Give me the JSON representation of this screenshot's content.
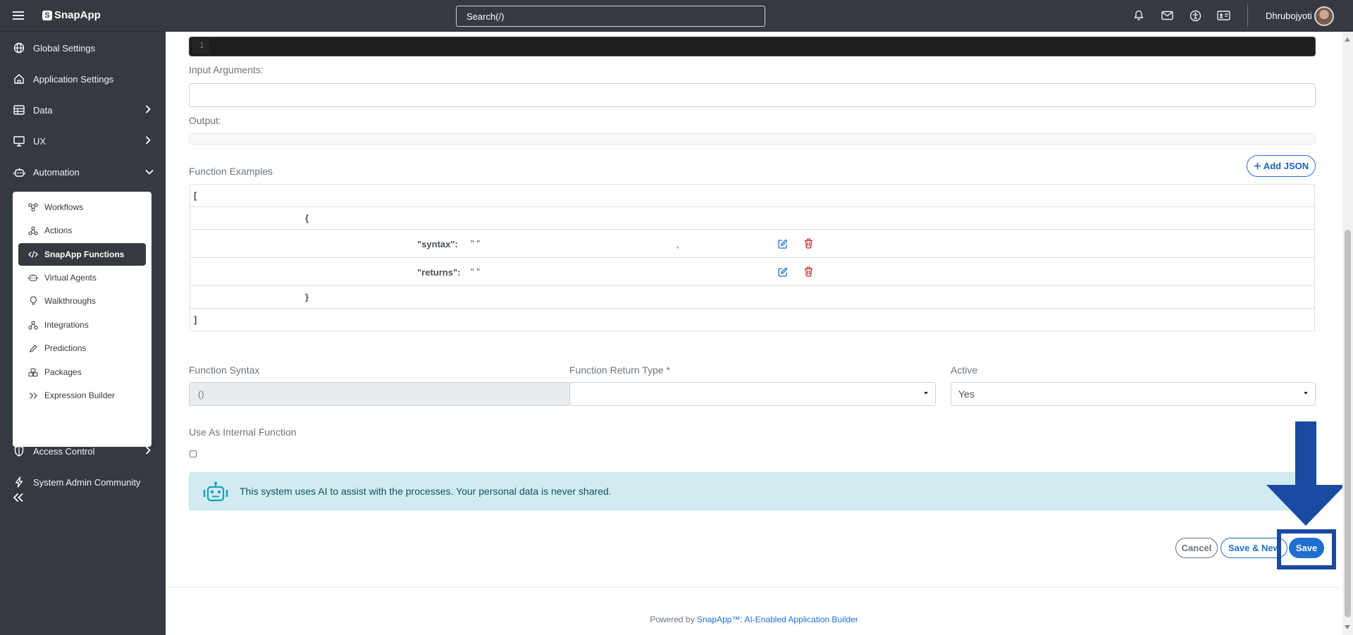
{
  "topbar": {
    "app_name": "SnapApp",
    "search_placeholder": "Search(/)",
    "user_name": "Dhrubojyoti",
    "icons": [
      "bell-icon",
      "mail-icon",
      "accessibility-icon",
      "id-card-icon"
    ]
  },
  "sidebar": {
    "items": [
      {
        "label": "Global Settings",
        "icon": "globe-icon"
      },
      {
        "label": "Application Settings",
        "icon": "home-icon"
      },
      {
        "label": "Data",
        "icon": "table-icon",
        "chevron": "right"
      },
      {
        "label": "UX",
        "icon": "monitor-icon",
        "chevron": "right"
      },
      {
        "label": "Automation",
        "icon": "robot-icon",
        "chevron": "down"
      },
      {
        "label": "Access Control",
        "icon": "shield-icon",
        "chevron": "right"
      },
      {
        "label": "System Admin Community",
        "icon": "bolt-icon"
      }
    ],
    "submenu": [
      {
        "label": "Workflows",
        "icon": "workflow-icon"
      },
      {
        "label": "Actions",
        "icon": "actions-icon"
      },
      {
        "label": "SnapApp Functions",
        "icon": "code-icon",
        "active": true
      },
      {
        "label": "Virtual Agents",
        "icon": "robot-icon"
      },
      {
        "label": "Walkthroughs",
        "icon": "lightbulb-icon"
      },
      {
        "label": "Integrations",
        "icon": "integrations-icon"
      },
      {
        "label": "Predictions",
        "icon": "pencil-icon"
      },
      {
        "label": "Packages",
        "icon": "packages-icon"
      },
      {
        "label": "Expression Builder",
        "icon": "double-chevron-icon"
      }
    ]
  },
  "editor": {
    "line_number": "1"
  },
  "form": {
    "input_arguments_label": "Input Arguments:",
    "output_label": "Output:",
    "function_examples_label": "Function Examples",
    "add_json_label": "Add JSON",
    "json": {
      "open_bracket": "[",
      "open_brace": "{",
      "syntax_key": "\"syntax\":",
      "syntax_value": "\" \"",
      "comma": ",",
      "returns_key": "\"returns\":",
      "returns_value": "\" \"",
      "close_brace": "}",
      "close_bracket": "]"
    },
    "function_syntax_label": "Function Syntax",
    "function_syntax_value": "()",
    "return_type_label": "Function Return Type *",
    "return_type_value": "",
    "active_label": "Active",
    "active_value": "Yes",
    "internal_function_label": "Use As Internal Function",
    "internal_function_checked": false
  },
  "ai_banner": {
    "message": "This system uses AI to assist with the processes. Your personal data is never shared."
  },
  "actions": {
    "cancel_label": "Cancel",
    "save_new_label": "Save & New",
    "save_label": "Save"
  },
  "footer": {
    "prefix": "Powered by ",
    "link_text": "SnapApp™: AI-Enabled Application Builder"
  },
  "colors": {
    "sidebar_bg": "#343a40",
    "accent": "#1f6fd1",
    "annotation": "#1b4aa3",
    "info_bg": "#d1ecf1"
  }
}
